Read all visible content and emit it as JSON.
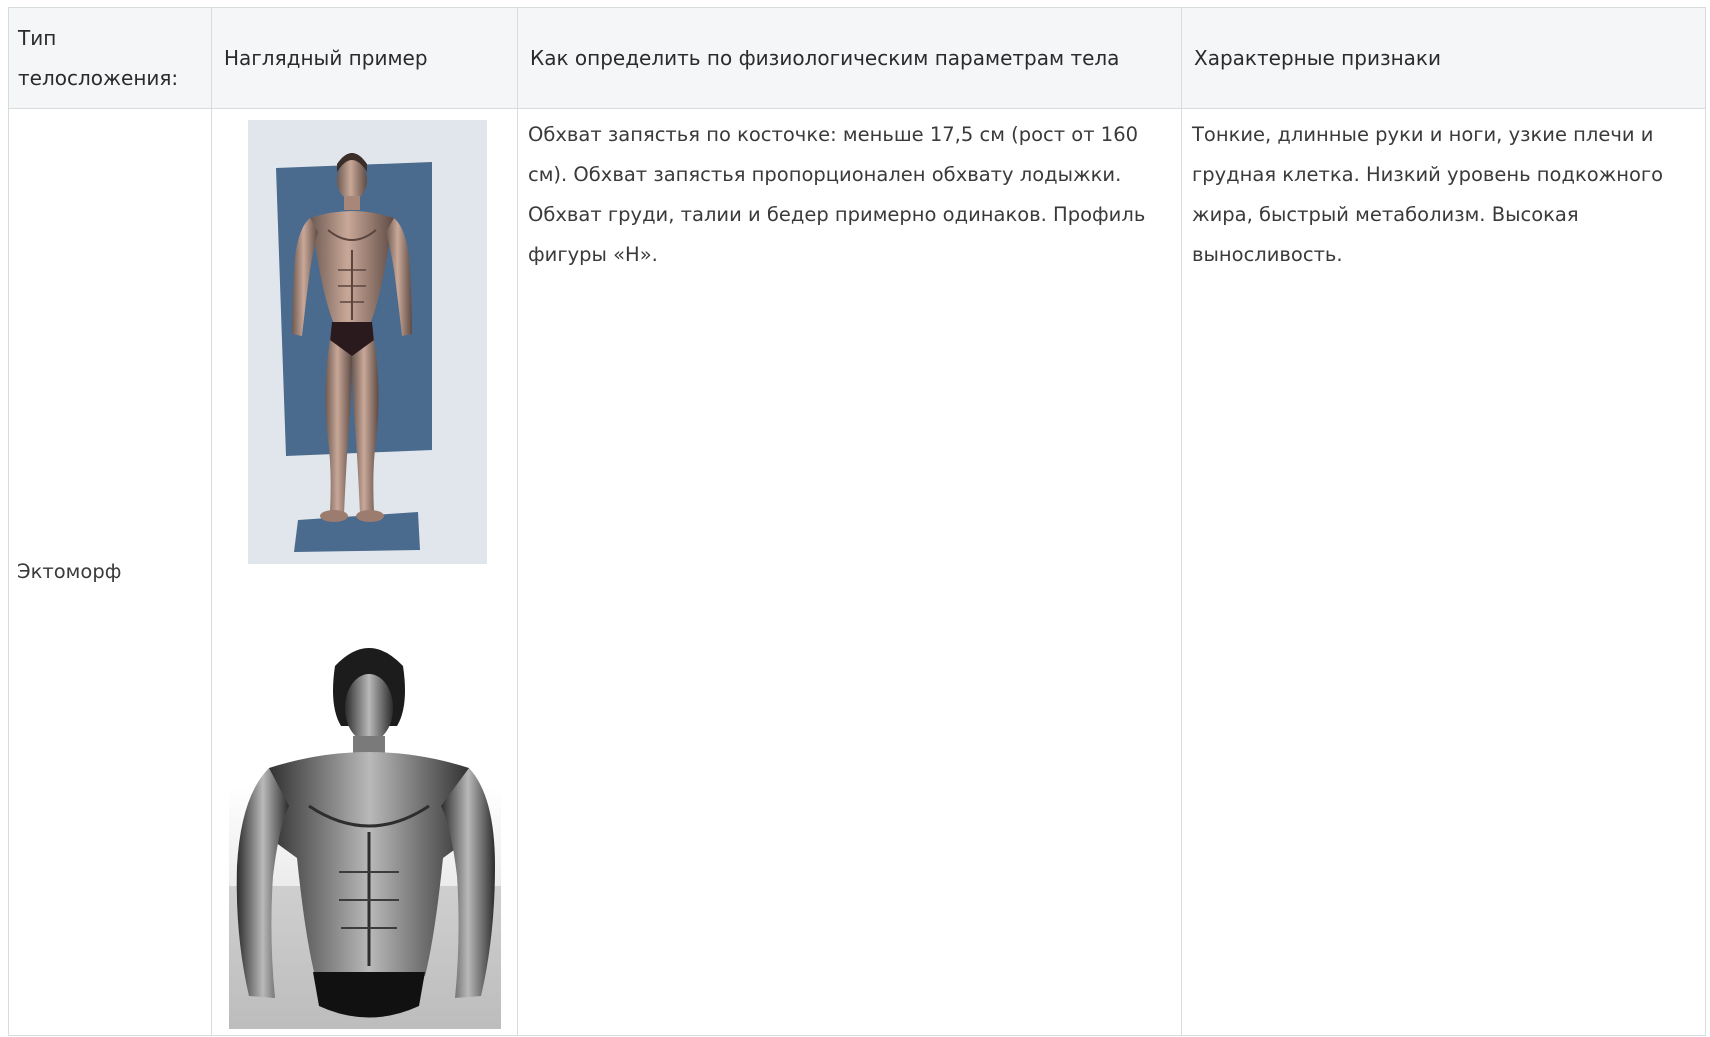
{
  "table": {
    "headers": [
      "Тип телосложения:",
      "Наглядный пример",
      "Как определить по физиологическим параметрам тела",
      "Характерные признаки"
    ],
    "rows": [
      {
        "type": "Эктоморф",
        "how_to_identify": "Обхват запястья по косточке: меньше 17,5 см (рост от 160 см). Обхват запястья пропорционален обхвату лодыжки. Обхват груди, талии и бедер примерно одинаков. Профиль фигуры «Н».",
        "traits": "Тонкие, длинные руки и ноги, узкие плечи и грудная клетка. Низкий уровень подкожного жира, быстрый метаболизм. Высокая выносливость."
      }
    ]
  },
  "colors": {
    "border": "#d7dcdf",
    "header_bg": "#f4f6f7",
    "illustration_panel": "#4a6a8e"
  }
}
